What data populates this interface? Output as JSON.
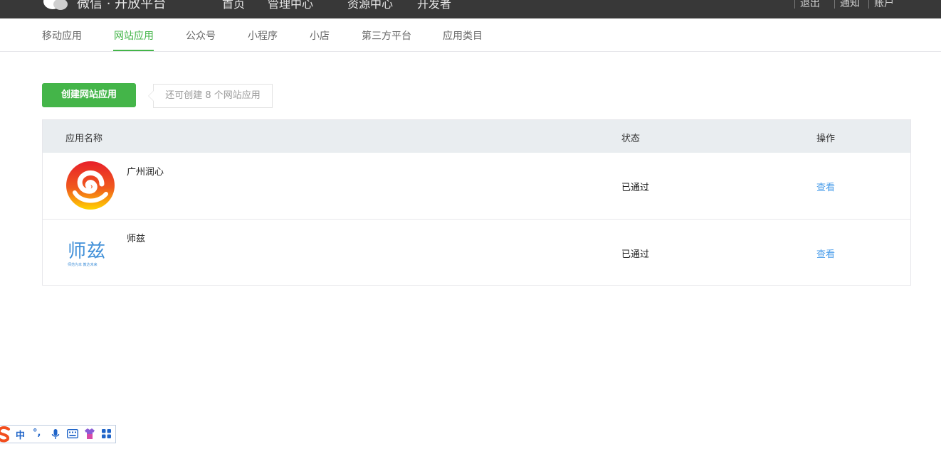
{
  "topbar": {
    "brand": "微信 · 开放平台",
    "menu": [
      "首页",
      "管理中心",
      "资源中心",
      "开发者"
    ],
    "right": [
      "退出",
      "通知",
      "账户"
    ]
  },
  "subnav": {
    "tabs": [
      "移动应用",
      "网站应用",
      "公众号",
      "小程序",
      "小店",
      "第三方平台",
      "应用类目"
    ],
    "active_index": 1
  },
  "actions": {
    "create_label": "创建网站应用",
    "tip": "还可创建 8 个网站应用"
  },
  "table": {
    "headers": [
      "应用名称",
      "状态",
      "操作"
    ],
    "rows": [
      {
        "name": "广州润心",
        "status": "已通过",
        "action": "查看",
        "icon": "runxin-logo"
      },
      {
        "name": "师兹",
        "status": "已通过",
        "action": "查看",
        "icon": "shizi-logo"
      }
    ]
  },
  "shizi_logo": {
    "text": "师兹",
    "tagline": "师范为本 教达未来"
  },
  "ime": {
    "mode": "中",
    "punct": "°,"
  },
  "colors": {
    "accent_green": "#44b549",
    "link_blue": "#459ae9",
    "topbar_bg": "#383838",
    "table_header_bg": "#e9edf0"
  }
}
